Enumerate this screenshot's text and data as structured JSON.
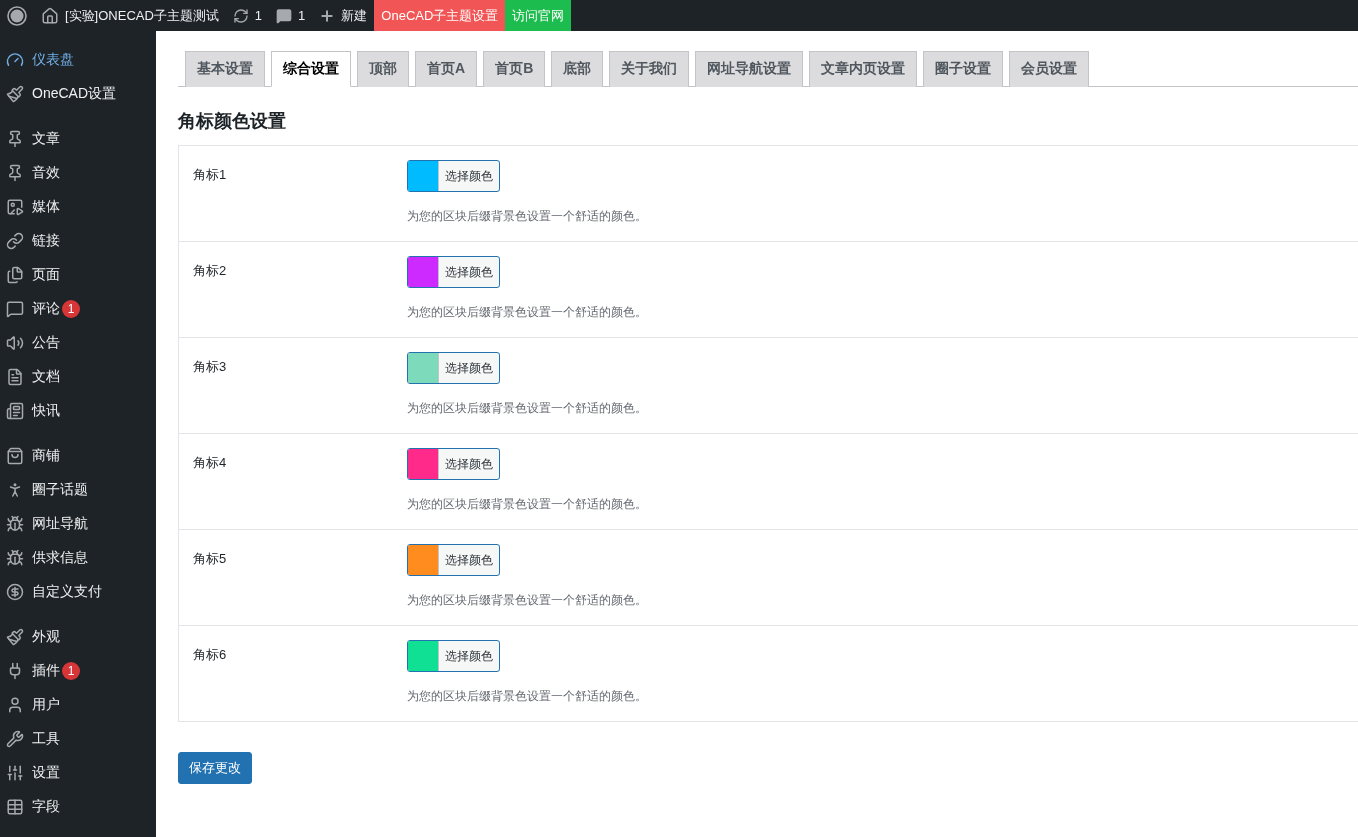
{
  "top_bar": {
    "site_title": "[实验]ONECAD子主题测试",
    "updates": "1",
    "comments": "1",
    "new": "新建",
    "links": [
      {
        "label": "OneCAD子主题设置",
        "color": "#f25555"
      },
      {
        "label": "访问官网",
        "color": "#1cbd4e"
      }
    ]
  },
  "sidebar": {
    "groups": [
      [
        {
          "label": "仪表盘",
          "selected": true
        },
        {
          "label": "OneCAD设置",
          "selected": false
        }
      ],
      [
        {
          "label": "文章",
          "selected": false
        },
        {
          "label": "音效",
          "selected": false
        },
        {
          "label": "媒体",
          "selected": false
        },
        {
          "label": "链接",
          "selected": false
        },
        {
          "label": "页面",
          "selected": false
        },
        {
          "label": "评论",
          "selected": false,
          "badge": "1"
        },
        {
          "label": "公告",
          "selected": false
        },
        {
          "label": "文档",
          "selected": false
        },
        {
          "label": "快讯",
          "selected": false
        }
      ],
      [
        {
          "label": "商铺",
          "selected": false
        },
        {
          "label": "圈子话题",
          "selected": false
        },
        {
          "label": "网址导航",
          "selected": false
        },
        {
          "label": "供求信息",
          "selected": false
        },
        {
          "label": "自定义支付",
          "selected": false
        }
      ],
      [
        {
          "label": "外观",
          "selected": false
        },
        {
          "label": "插件",
          "selected": false,
          "badge": "1"
        },
        {
          "label": "用户",
          "selected": false
        },
        {
          "label": "工具",
          "selected": false
        },
        {
          "label": "设置",
          "selected": false
        },
        {
          "label": "字段",
          "selected": false
        }
      ]
    ]
  },
  "tabs": [
    {
      "label": "基本设置",
      "selected": false
    },
    {
      "label": "综合设置",
      "selected": true
    },
    {
      "label": "顶部",
      "selected": false
    },
    {
      "label": "首页A",
      "selected": false
    },
    {
      "label": "首页B",
      "selected": false
    },
    {
      "label": "底部",
      "selected": false
    },
    {
      "label": "关于我们",
      "selected": false
    },
    {
      "label": "网址导航设置",
      "selected": false
    },
    {
      "label": "文章内页设置",
      "selected": false
    },
    {
      "label": "圈子设置",
      "selected": false
    },
    {
      "label": "会员设置",
      "selected": false
    }
  ],
  "section_title": "角标颜色设置",
  "rows": [
    {
      "label": "角标1",
      "color": "#00bbff",
      "button": "选择颜色",
      "description": "为您的区块后缀背景色设置一个舒适的颜色。"
    },
    {
      "label": "角标2",
      "color": "#cc2aff",
      "button": "选择颜色",
      "description": "为您的区块后缀背景色设置一个舒适的颜色。"
    },
    {
      "label": "角标3",
      "color": "#7ddbbb",
      "button": "选择颜色",
      "description": "为您的区块后缀背景色设置一个舒适的颜色。"
    },
    {
      "label": "角标4",
      "color": "#ff2a8a",
      "button": "选择颜色",
      "description": "为您的区块后缀背景色设置一个舒适的颜色。"
    },
    {
      "label": "角标5",
      "color": "#ff8c1f",
      "button": "选择颜色",
      "description": "为您的区块后缀背景色设置一个舒适的颜色。"
    },
    {
      "label": "角标6",
      "color": "#10e093",
      "button": "选择颜色",
      "description": "为您的区块后缀背景色设置一个舒适的颜色。"
    }
  ],
  "save_button": "保存更改"
}
